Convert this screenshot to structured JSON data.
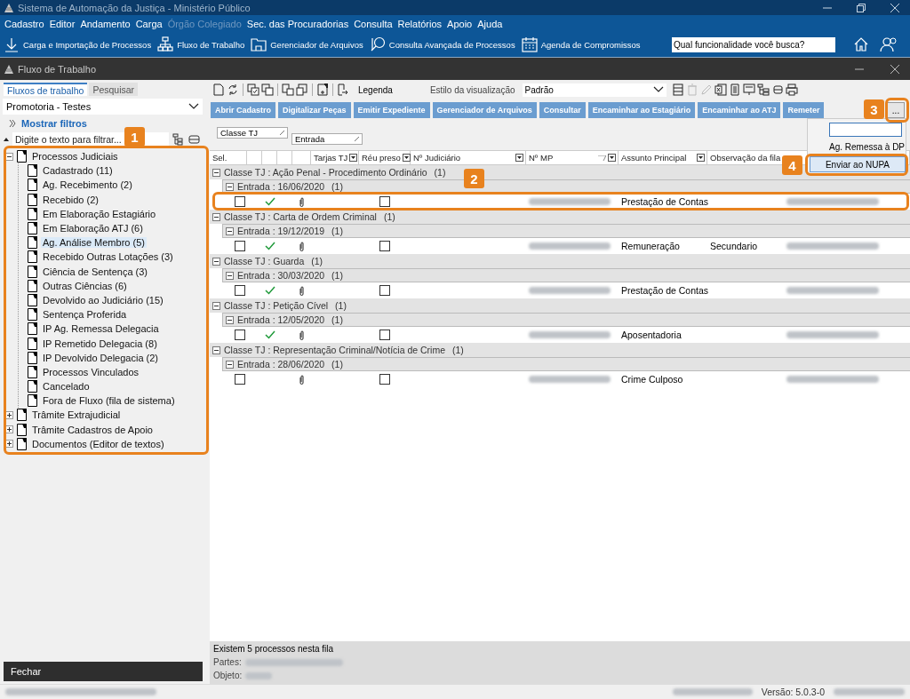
{
  "app": {
    "title": "Sistema de Automação da Justiça - Ministério Público"
  },
  "menu": [
    {
      "label": "Cadastro",
      "disabled": false
    },
    {
      "label": "Editor",
      "disabled": false
    },
    {
      "label": "Andamento",
      "disabled": false
    },
    {
      "label": "Carga",
      "disabled": false
    },
    {
      "label": "Órgão Colegiado",
      "disabled": true
    },
    {
      "label": "Sec. das Procuradorias",
      "disabled": false
    },
    {
      "label": "Consulta",
      "disabled": false
    },
    {
      "label": "Relatórios",
      "disabled": false
    },
    {
      "label": "Apoio",
      "disabled": false
    },
    {
      "label": "Ajuda",
      "disabled": false
    }
  ],
  "toolbar": [
    {
      "label": "Carga e Importação de Processos",
      "kind": "download"
    },
    {
      "label": "Fluxo de Trabalho",
      "kind": "flow"
    },
    {
      "label": "Gerenciador de Arquivos",
      "kind": "folder"
    },
    {
      "label": "Consulta Avançada de Processos",
      "kind": "search"
    },
    {
      "label": "Agenda de Compromissos",
      "kind": "calendar"
    }
  ],
  "search": {
    "placeholder": "Qual funcionalidade você busca?"
  },
  "window": {
    "title": "Fluxo de Trabalho"
  },
  "side_tabs": [
    {
      "label": "Fluxos de trabalho",
      "selected": true
    },
    {
      "label": "Pesquisar",
      "selected": false
    }
  ],
  "profile": {
    "value": "Promotoria - Testes"
  },
  "show_filters": "Mostrar filtros",
  "filter": {
    "placeholder": "Digite o texto para filtrar..."
  },
  "tree": [
    {
      "label": "Processos Judiciais",
      "expanded": true,
      "selected": false,
      "children": [
        {
          "label": "Cadastrado (11)",
          "selected": false
        },
        {
          "label": "Ag. Recebimento (2)",
          "selected": false
        },
        {
          "label": "Recebido (2)",
          "selected": false
        },
        {
          "label": "Em Elaboração Estagiário",
          "selected": false
        },
        {
          "label": "Em Elaboração ATJ (6)",
          "selected": false
        },
        {
          "label": "Ag. Análise Membro (5)",
          "selected": true
        },
        {
          "label": "Recebido Outras Lotações (3)",
          "selected": false
        },
        {
          "label": "Ciência de Sentença (3)",
          "selected": false
        },
        {
          "label": "Outras Ciências (6)",
          "selected": false
        },
        {
          "label": "Devolvido ao Judiciário (15)",
          "selected": false
        },
        {
          "label": "Sentença Proferida",
          "selected": false
        },
        {
          "label": "IP Ag. Remessa Delegacia",
          "selected": false
        },
        {
          "label": "IP Remetido Delegacia (8)",
          "selected": false
        },
        {
          "label": "IP Devolvido Delegacia (2)",
          "selected": false
        },
        {
          "label": "Processos Vinculados",
          "selected": false
        },
        {
          "label": "Cancelado",
          "selected": false
        },
        {
          "label": "Fora de Fluxo (fila de sistema)",
          "selected": false
        }
      ]
    },
    {
      "label": "Trâmite Extrajudicial",
      "expanded": false,
      "selected": false
    },
    {
      "label": "Trâmite Cadastros de Apoio",
      "expanded": false,
      "selected": false
    },
    {
      "label": "Documentos (Editor de textos)",
      "expanded": false,
      "selected": false
    }
  ],
  "close_button": "Fechar",
  "grid_toolbar": {
    "legend": "Legenda",
    "style_label": "Estilo da visualização",
    "style_value": "Padrão"
  },
  "actions": [
    "Abrir Cadastro",
    "Digitalizar Peças",
    "Emitir Expediente",
    "Gerenciador de Arquivos",
    "Consultar",
    "Encaminhar ao Estagiário",
    "Encaminhar ao ATJ",
    "Remeter"
  ],
  "more_button": "...",
  "group_by": [
    "Classe TJ",
    "Entrada"
  ],
  "columns": [
    {
      "label": "Sel.",
      "filter": false,
      "sort": false
    },
    {
      "label": "Tarjas TJ",
      "filter": true,
      "sort": false
    },
    {
      "label": "Réu preso",
      "filter": true,
      "sort": false
    },
    {
      "label": "Nº Judiciário",
      "filter": true,
      "sort": false
    },
    {
      "label": "Nº MP",
      "filter": true,
      "sort": true
    },
    {
      "label": "Assunto Principal",
      "filter": true,
      "sort": false
    },
    {
      "label": "Observação da fila"
    }
  ],
  "groups": [
    {
      "label": "Classe TJ : Ação Penal - Procedimento Ordinário",
      "count": "(1)",
      "expanded": true,
      "subgroups": [
        {
          "label": "Entrada : 16/06/2020",
          "count": "(1)",
          "expanded": true,
          "rows": [
            {
              "checked": false,
              "validated": true,
              "attachment": true,
              "reu_preso": false,
              "subject": "Prestação de Contas"
            }
          ]
        }
      ]
    },
    {
      "label": "Classe TJ : Carta de Ordem Criminal",
      "count": "(1)",
      "expanded": true,
      "subgroups": [
        {
          "label": "Entrada : 19/12/2019",
          "count": "(1)",
          "expanded": true,
          "rows": [
            {
              "checked": false,
              "validated": true,
              "attachment": true,
              "reu_preso": false,
              "subject": "Remuneração",
              "note": "Secundario"
            }
          ]
        }
      ]
    },
    {
      "label": "Classe TJ : Guarda",
      "count": "(1)",
      "expanded": true,
      "subgroups": [
        {
          "label": "Entrada : 30/03/2020",
          "count": "(1)",
          "expanded": true,
          "rows": [
            {
              "checked": false,
              "validated": true,
              "attachment": true,
              "reu_preso": false,
              "subject": "Prestação de Contas"
            }
          ]
        }
      ]
    },
    {
      "label": "Classe TJ : Petição Cível",
      "count": "(1)",
      "expanded": true,
      "subgroups": [
        {
          "label": "Entrada : 12/05/2020",
          "count": "(1)",
          "expanded": true,
          "rows": [
            {
              "checked": false,
              "validated": true,
              "attachment": true,
              "reu_preso": false,
              "subject": "Aposentadoria"
            }
          ]
        }
      ]
    },
    {
      "label": "Classe TJ : Representação Criminal/Notícia de Crime",
      "count": "(1)",
      "expanded": true,
      "subgroups": [
        {
          "label": "Entrada : 28/06/2020",
          "count": "(1)",
          "expanded": true,
          "rows": [
            {
              "checked": false,
              "validated": false,
              "attachment": true,
              "reu_preso": false,
              "subject": "Crime Culposo"
            }
          ]
        }
      ]
    }
  ],
  "popup": {
    "items": [
      {
        "label": "Ag. Remessa à DP",
        "kind": "text"
      },
      {
        "label": "Enviar ao NUPA",
        "kind": "button"
      }
    ]
  },
  "footer": {
    "summary": "Existem 5 processos nesta fila",
    "parties_label": "Partes:",
    "object_label": "Objeto:"
  },
  "status_bar": {
    "version": "Versão: 5.0.3-0"
  },
  "callouts": [
    "1",
    "2",
    "3",
    "4"
  ]
}
